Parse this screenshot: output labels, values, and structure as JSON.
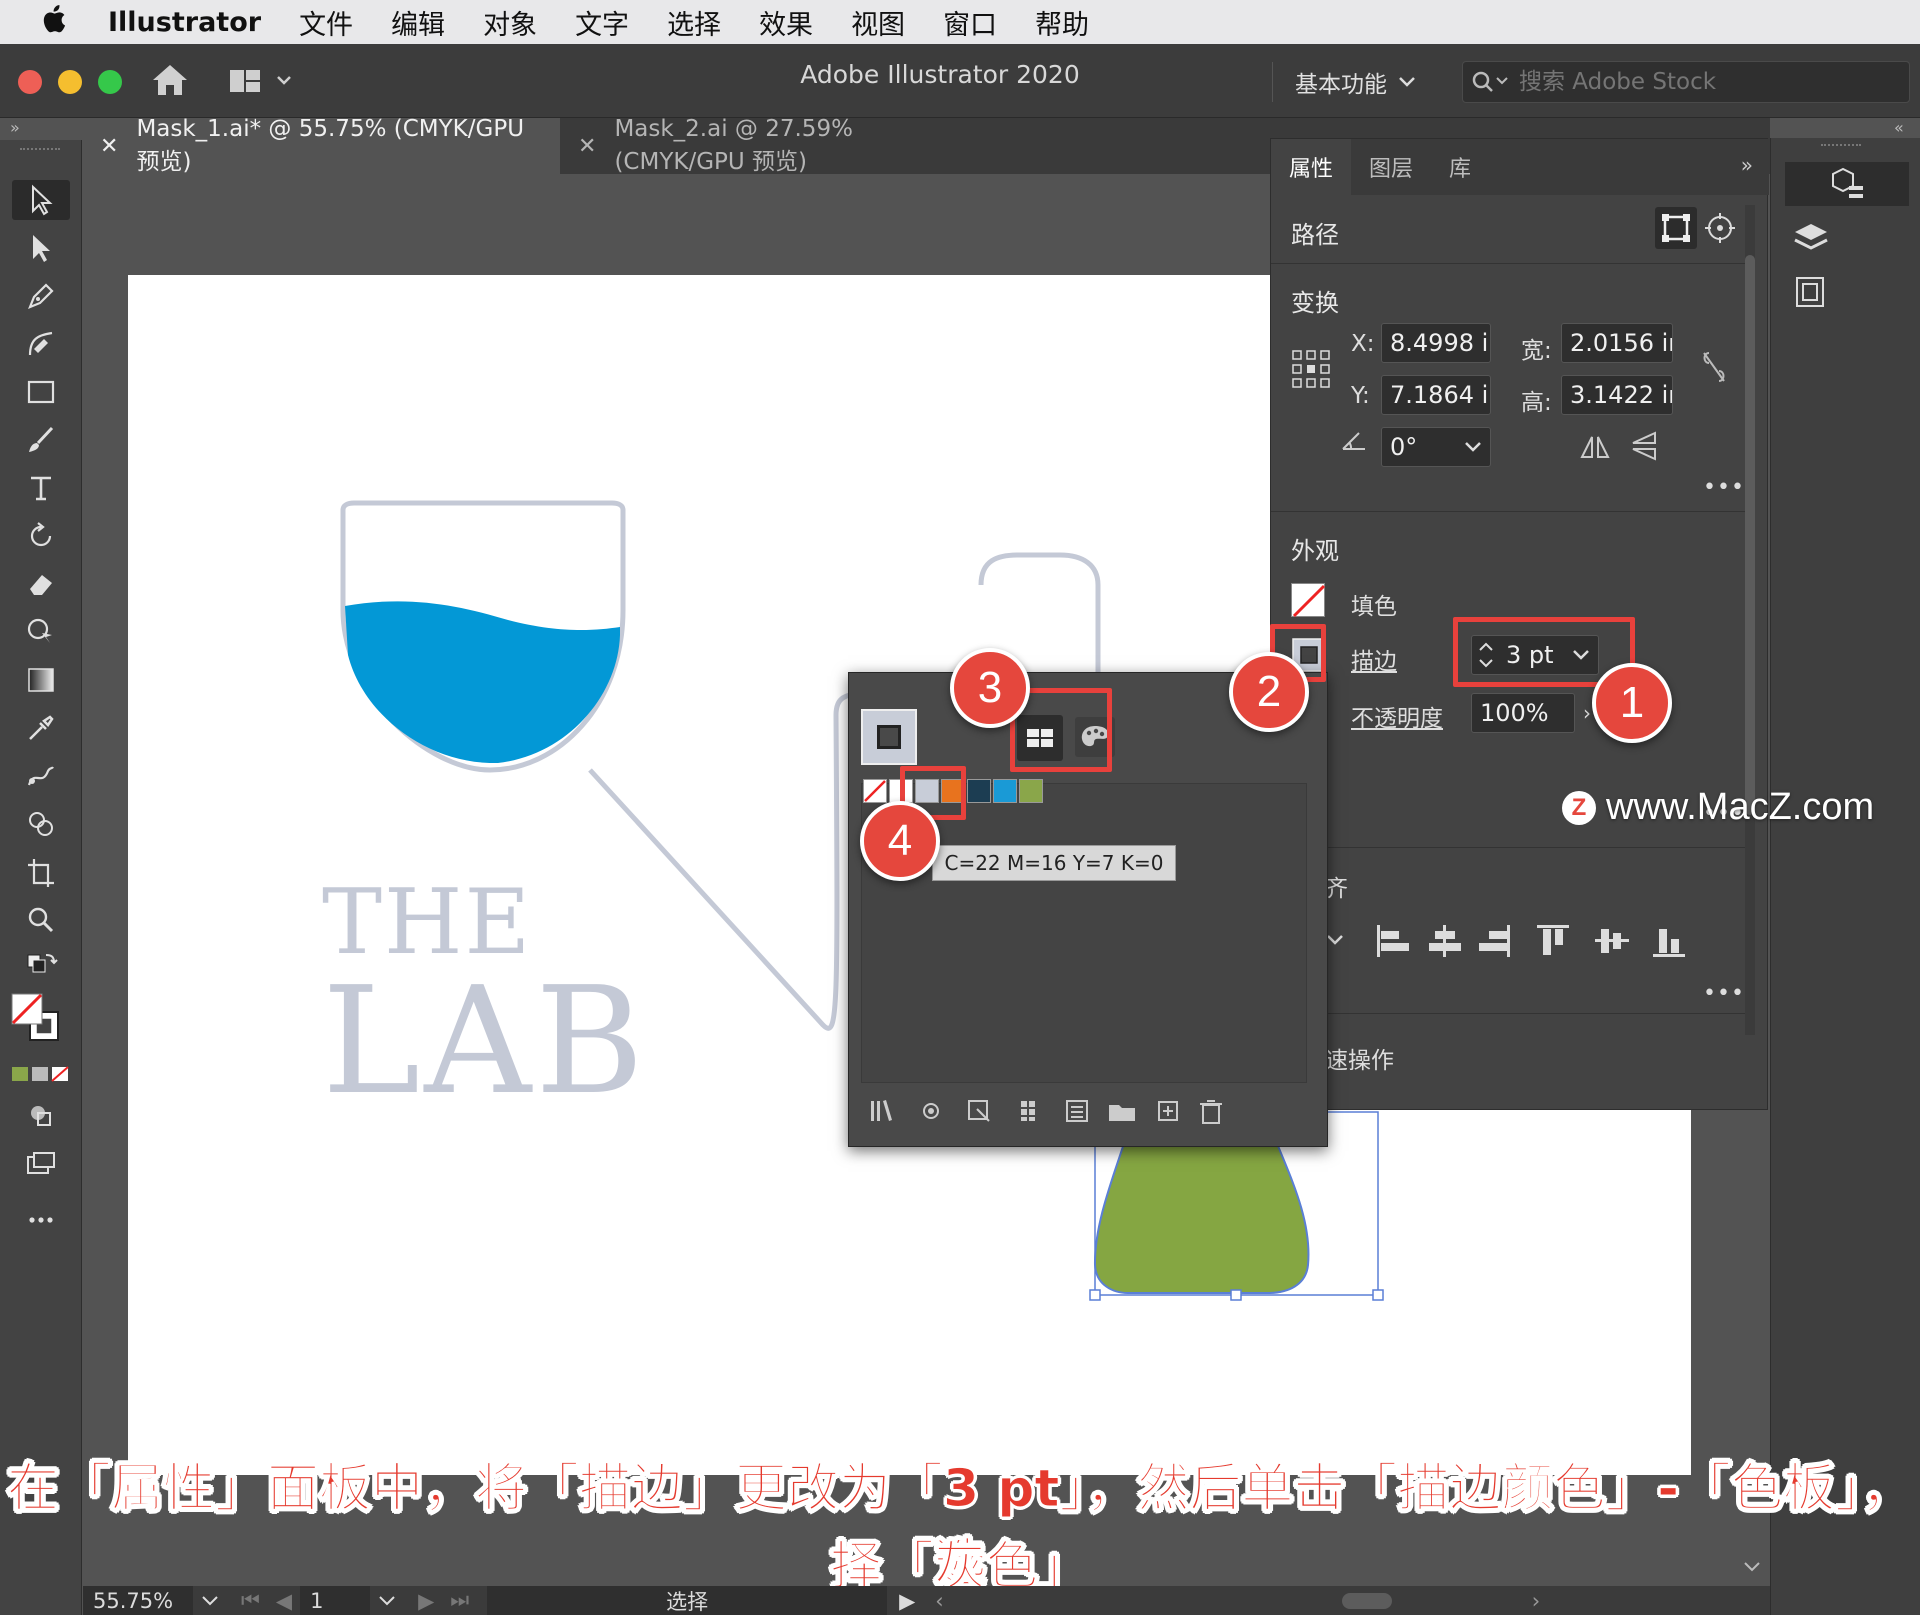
{
  "menubar": {
    "apple_icon": "apple-icon",
    "app_name": "Illustrator",
    "items": [
      "文件",
      "编辑",
      "对象",
      "文字",
      "选择",
      "效果",
      "视图",
      "窗口",
      "帮助"
    ]
  },
  "titlebar": {
    "title": "Adobe Illustrator 2020",
    "workspace_label": "基本功能",
    "stock_search_placeholder": "搜索 Adobe Stock"
  },
  "tabs": [
    {
      "label": "Mask_1.ai* @ 55.75% (CMYK/GPU 预览)",
      "active": true
    },
    {
      "label": "Mask_2.ai @ 27.59% (CMYK/GPU 预览)",
      "active": false
    }
  ],
  "panel": {
    "tabs": [
      "属性",
      "图层",
      "库"
    ],
    "path_label": "路径",
    "transform_label": "变换",
    "x_label": "X:",
    "x_value": "8.4998 i",
    "y_label": "Y:",
    "y_value": "7.1864 i",
    "w_label": "宽:",
    "w_value": "2.0156 ir",
    "h_label": "高:",
    "h_value": "3.1422 ir",
    "angle_value": "0°",
    "appearance_label": "外观",
    "fill_label": "填色",
    "stroke_label": "描边",
    "stroke_weight": "3 pt",
    "opacity_label": "不透明度",
    "opacity_value": "100%",
    "align_label_partial": "齐",
    "quick_actions_partial": "速操作"
  },
  "swatches": {
    "tooltip": "C=22 M=16 Y=7 K=0",
    "colors": [
      "#ffffff",
      "#c8cdd8",
      "#e8731e",
      "#1c3d52",
      "#1a9ad6",
      "#8aa64a"
    ]
  },
  "artwork": {
    "logo_line1": "THE",
    "logo_line2": "LAB",
    "accent_blue": "#0398d6",
    "accent_green": "#85a642",
    "outline_gray": "#c4c9d6"
  },
  "annotations": {
    "badges": [
      "1",
      "2",
      "3",
      "4"
    ],
    "highlight_color": "#e8413c"
  },
  "watermark": {
    "logo_letter": "Z",
    "text": "www.MacZ.com"
  },
  "caption": {
    "line1": "在「属性」面板中，将「描边」更改为「3 pt」，然后单击「描边颜色」-「色板」，选",
    "line2": "择「灰色」"
  },
  "statusbar": {
    "zoom": "55.75%",
    "artboard_number": "1",
    "mode": "选择"
  }
}
